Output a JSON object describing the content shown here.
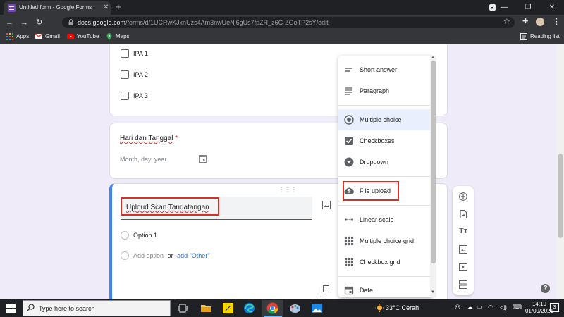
{
  "browser": {
    "tab_title": "Untitled form - Google Forms",
    "url_host": "docs.google.com",
    "url_path": "/forms/d/1UCRwKJxnUzs4Am3nwUeNj6gUs7fpZR_z6C-ZGoTP2sY/edit",
    "bookmarks": [
      {
        "label": "Apps",
        "icon": "apps-grid-icon"
      },
      {
        "label": "Gmail",
        "icon": "gmail-icon"
      },
      {
        "label": "YouTube",
        "icon": "youtube-icon"
      },
      {
        "label": "Maps",
        "icon": "maps-icon"
      }
    ],
    "reading_list": "Reading list"
  },
  "form": {
    "checkbox_options": [
      "IPA 1",
      "IPA 2",
      "IPA 3"
    ],
    "date_question": {
      "title": "Hari dan Tanggal",
      "required_mark": "*",
      "placeholder": "Month, day, year"
    },
    "active_question": {
      "title": "Uploud Scan Tandatangan",
      "options": [
        "Option 1"
      ],
      "add_option": "Add option",
      "or": "or",
      "add_other": "add \"Other\""
    }
  },
  "question_type_menu": {
    "items": [
      {
        "label": "Short answer",
        "icon": "short-answer-icon",
        "selected": false,
        "highlighted": false
      },
      {
        "label": "Paragraph",
        "icon": "paragraph-icon",
        "selected": false,
        "highlighted": false
      },
      {
        "label": "Multiple choice",
        "icon": "radio-button-icon",
        "selected": true,
        "highlighted": false
      },
      {
        "label": "Checkboxes",
        "icon": "checkbox-icon",
        "selected": false,
        "highlighted": false
      },
      {
        "label": "Dropdown",
        "icon": "dropdown-icon",
        "selected": false,
        "highlighted": false
      },
      {
        "label": "File upload",
        "icon": "cloud-upload-icon",
        "selected": false,
        "highlighted": true
      },
      {
        "label": "Linear scale",
        "icon": "linear-scale-icon",
        "selected": false,
        "highlighted": false
      },
      {
        "label": "Multiple choice grid",
        "icon": "grid-dots-icon",
        "selected": false,
        "highlighted": false
      },
      {
        "label": "Checkbox grid",
        "icon": "grid-squares-icon",
        "selected": false,
        "highlighted": false
      },
      {
        "label": "Date",
        "icon": "calendar-icon",
        "selected": false,
        "highlighted": false
      }
    ]
  },
  "side_toolbar": [
    "add-question-icon",
    "import-questions-icon",
    "add-title-icon",
    "add-image-icon",
    "add-video-icon",
    "add-section-icon"
  ],
  "taskbar": {
    "search_placeholder": "Type here to search",
    "temperature": "33°C",
    "weather": "Cerah",
    "time": "14:19",
    "date": "01/09/2021",
    "notifications": "3"
  },
  "colors": {
    "accent": "#673ab7",
    "highlight_box": "#d93025",
    "link": "#1a73e8",
    "selected_bg": "#e8f0fe"
  }
}
